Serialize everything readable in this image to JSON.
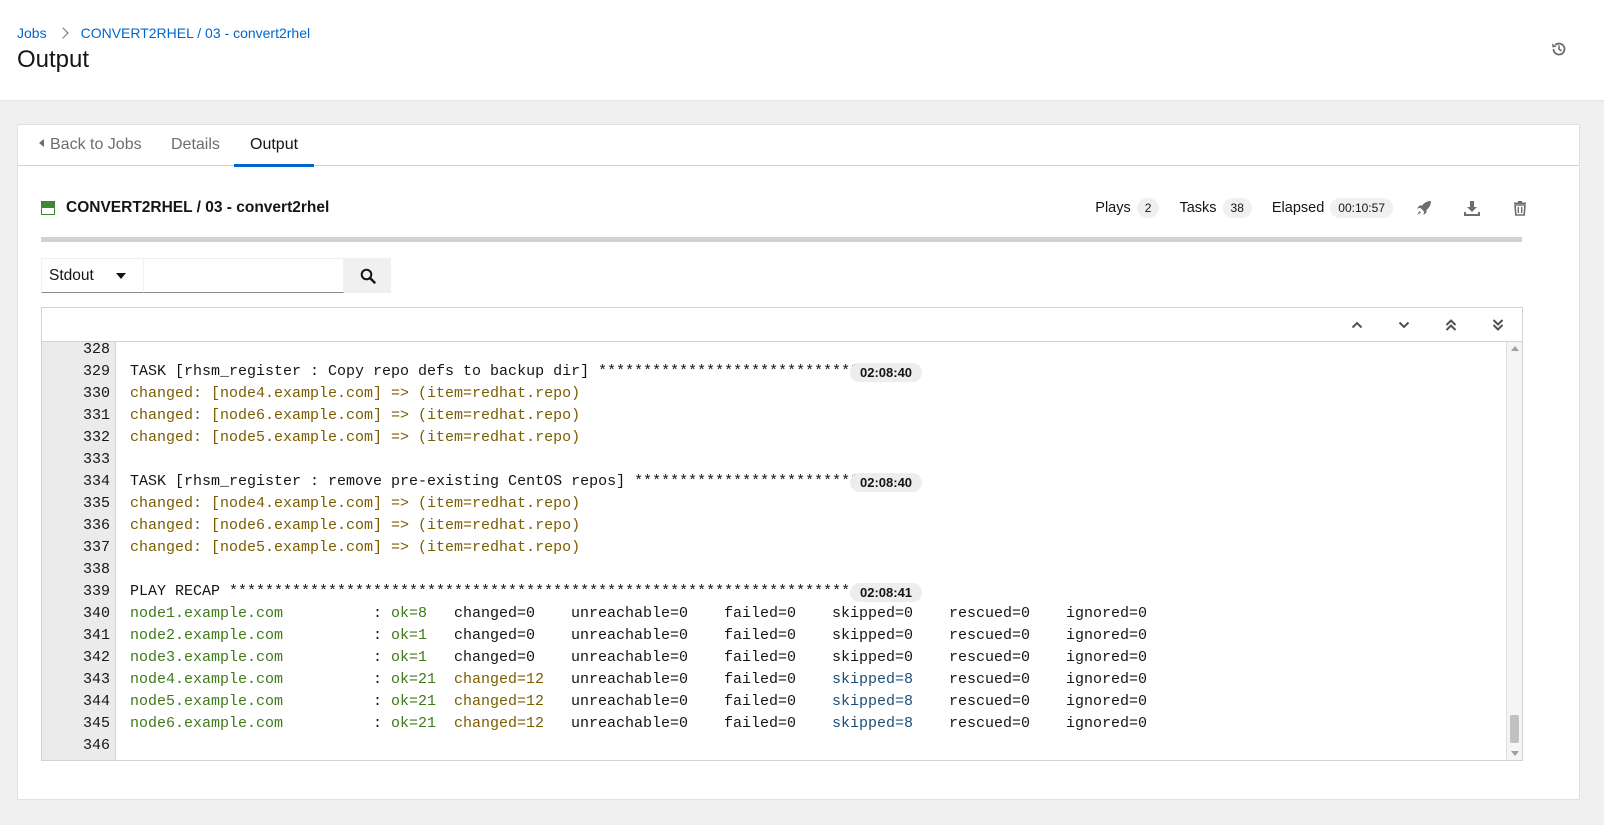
{
  "breadcrumb": {
    "jobs_label": "Jobs",
    "job_label": "CONVERT2RHEL / 03 - convert2rhel"
  },
  "page_title": "Output",
  "icons": {
    "history": "history-icon",
    "relaunch": "rocket-icon",
    "download": "download-icon",
    "delete": "trash-icon",
    "search": "search-icon"
  },
  "tabs": {
    "back": "Back to Jobs",
    "details": "Details",
    "output": "Output"
  },
  "job": {
    "name": "CONVERT2RHEL / 03 - convert2rhel",
    "status_color": "#3e8635",
    "plays_label": "Plays",
    "plays": "2",
    "tasks_label": "Tasks",
    "tasks": "38",
    "elapsed_label": "Elapsed",
    "elapsed": "00:10:57"
  },
  "search": {
    "select_value": "Stdout",
    "placeholder": ""
  },
  "colors": {
    "accent": "#0066cc",
    "changed": "#7a5d00",
    "ok": "#3e7a1a",
    "skipped": "#1b4f7a"
  },
  "lines": [
    {
      "n": "328"
    },
    {
      "n": "329",
      "text": "TASK [rhsm_register : Copy repo defs to backup dir] *****************************",
      "ts": "02:08:40"
    },
    {
      "n": "330",
      "changed": "changed: [node4.example.com] => (item=redhat.repo)"
    },
    {
      "n": "331",
      "changed": "changed: [node6.example.com] => (item=redhat.repo)"
    },
    {
      "n": "332",
      "changed": "changed: [node5.example.com] => (item=redhat.repo)"
    },
    {
      "n": "333"
    },
    {
      "n": "334",
      "text": "TASK [rhsm_register : remove pre-existing CentOS repos] *************************",
      "ts": "02:08:40"
    },
    {
      "n": "335",
      "changed": "changed: [node4.example.com] => (item=redhat.repo)"
    },
    {
      "n": "336",
      "changed": "changed: [node6.example.com] => (item=redhat.repo)"
    },
    {
      "n": "337",
      "changed": "changed: [node5.example.com] => (item=redhat.repo)"
    },
    {
      "n": "338"
    },
    {
      "n": "339",
      "text": "PLAY RECAP *********************************************************************",
      "ts": "02:08:41"
    },
    {
      "n": "340",
      "host": "node1.example.com",
      "ok": "ok=8",
      "chg": "changed=0",
      "unr": "unreachable=0",
      "fail": "failed=0",
      "skip": "skipped=0",
      "resc": "rescued=0",
      "ign": "ignored=0",
      "chg_hl": false,
      "skip_hl": false
    },
    {
      "n": "341",
      "host": "node2.example.com",
      "ok": "ok=1",
      "chg": "changed=0",
      "unr": "unreachable=0",
      "fail": "failed=0",
      "skip": "skipped=0",
      "resc": "rescued=0",
      "ign": "ignored=0",
      "chg_hl": false,
      "skip_hl": false
    },
    {
      "n": "342",
      "host": "node3.example.com",
      "ok": "ok=1",
      "chg": "changed=0",
      "unr": "unreachable=0",
      "fail": "failed=0",
      "skip": "skipped=0",
      "resc": "rescued=0",
      "ign": "ignored=0",
      "chg_hl": false,
      "skip_hl": false
    },
    {
      "n": "343",
      "host": "node4.example.com",
      "ok": "ok=21",
      "chg": "changed=12",
      "unr": "unreachable=0",
      "fail": "failed=0",
      "skip": "skipped=8",
      "resc": "rescued=0",
      "ign": "ignored=0",
      "chg_hl": true,
      "skip_hl": true
    },
    {
      "n": "344",
      "host": "node5.example.com",
      "ok": "ok=21",
      "chg": "changed=12",
      "unr": "unreachable=0",
      "fail": "failed=0",
      "skip": "skipped=8",
      "resc": "rescued=0",
      "ign": "ignored=0",
      "chg_hl": true,
      "skip_hl": true
    },
    {
      "n": "345",
      "host": "node6.example.com",
      "ok": "ok=21",
      "chg": "changed=12",
      "unr": "unreachable=0",
      "fail": "failed=0",
      "skip": "skipped=8",
      "resc": "rescued=0",
      "ign": "ignored=0",
      "chg_hl": true,
      "skip_hl": true
    },
    {
      "n": "346"
    }
  ]
}
